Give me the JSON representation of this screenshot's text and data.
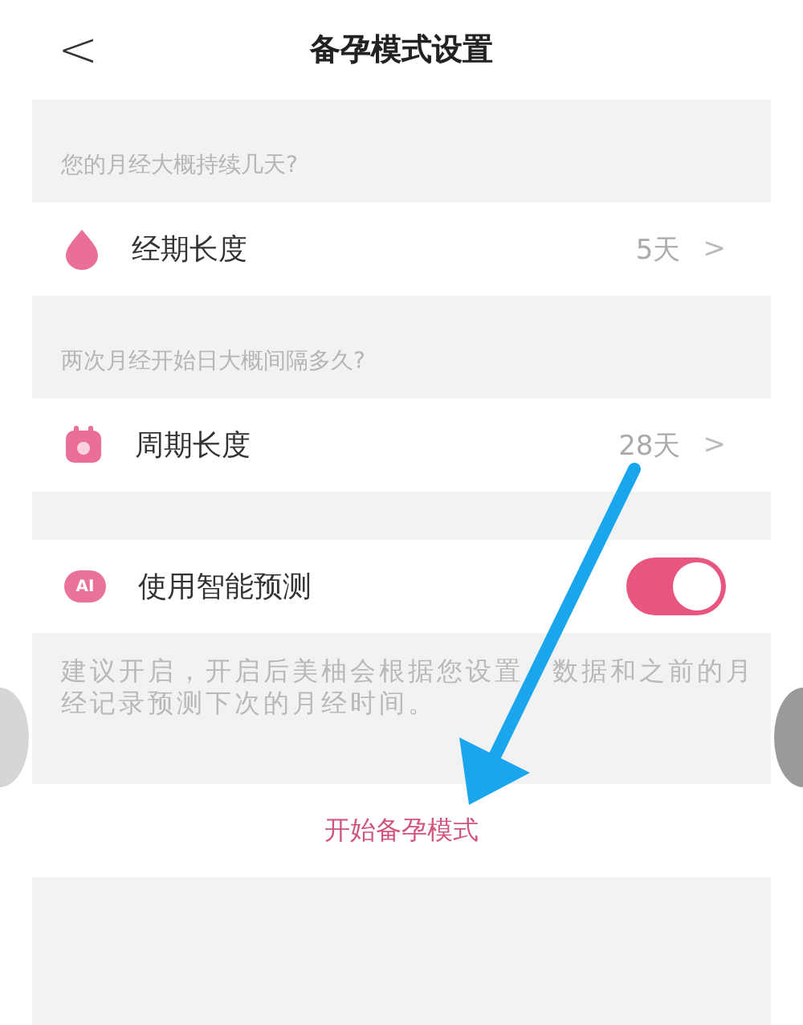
{
  "header": {
    "back": "<",
    "title": "备孕模式设置"
  },
  "sections": [
    {
      "question": "您的月经大概持续几天?",
      "row": {
        "kind": "drop",
        "label": "经期长度",
        "value": "5天",
        "chevron": ">"
      }
    },
    {
      "question": "两次月经开始日大概间隔多久?",
      "row": {
        "kind": "calendar",
        "label": "周期长度",
        "value": "28天",
        "chevron": ">"
      }
    }
  ],
  "prediction": {
    "icon_text": "AI",
    "label": "使用智能预测",
    "on": true,
    "note": "建议开启，开启后美柚会根据您设置　数据和之前的月经记录预测下次的月经时间。"
  },
  "start_button": "开始备孕模式"
}
